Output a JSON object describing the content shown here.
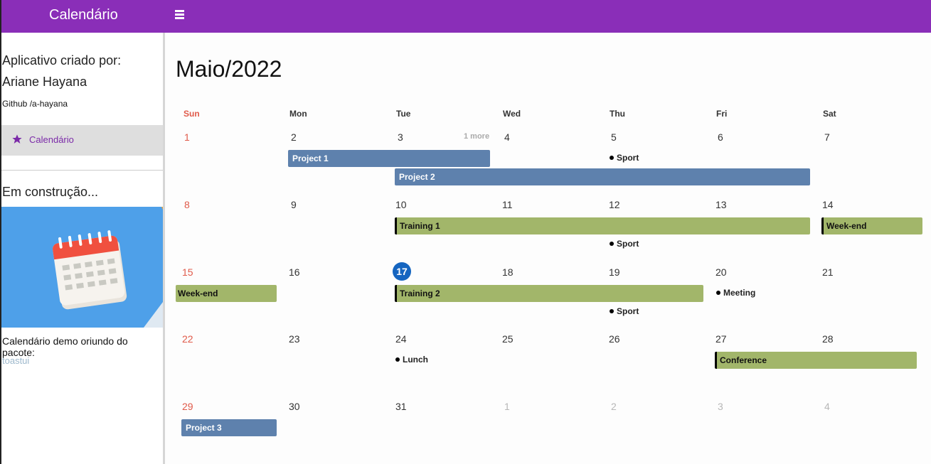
{
  "app": {
    "title": "Calendário",
    "menu_icon": "hamburger-icon"
  },
  "sidebar": {
    "created_by": "Aplicativo criado por:",
    "author": "Ariane Hayana",
    "github": "Github /a-hayana",
    "nav_item": {
      "label": "Calendário",
      "icon": "star-icon"
    },
    "construction": "Em construção...",
    "demo_text": "Calendário demo oriundo do pacote:",
    "package": "toastui"
  },
  "calendar": {
    "month_title": "Maio/2022",
    "weekdays": [
      "Sun",
      "Mon",
      "Tue",
      "Wed",
      "Thu",
      "Fri",
      "Sat"
    ],
    "weeks": [
      [
        "1",
        "2",
        "3",
        "4",
        "5",
        "6",
        "7"
      ],
      [
        "8",
        "9",
        "10",
        "11",
        "12",
        "13",
        "14"
      ],
      [
        "15",
        "16",
        "17",
        "18",
        "19",
        "20",
        "21"
      ],
      [
        "22",
        "23",
        "24",
        "25",
        "26",
        "27",
        "28"
      ],
      [
        "29",
        "30",
        "31",
        "1",
        "2",
        "3",
        "4"
      ]
    ],
    "today": "17",
    "more_label": "1 more",
    "events": {
      "project1": "Project 1",
      "project2": "Project 2",
      "sport": "Sport",
      "training1": "Training 1",
      "weekend": "Week-end",
      "training2": "Training 2",
      "meeting": "Meeting",
      "lunch": "Lunch",
      "conference": "Conference",
      "project3": "Project 3"
    },
    "colors": {
      "sunday": "#e05a4a",
      "today": "#1565c0",
      "blue_event": "#5e81ad",
      "green_event": "#a2b66a",
      "accent": "#8a2eb8"
    }
  }
}
